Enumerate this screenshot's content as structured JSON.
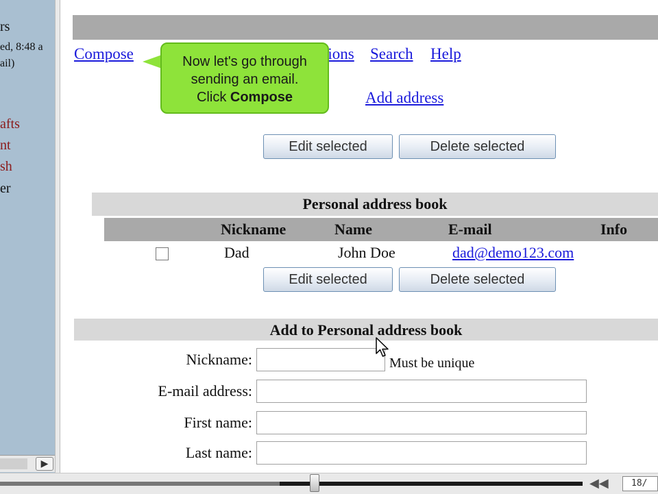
{
  "sidebar": {
    "lines": [
      "rs",
      "ed, 8:48 a",
      "ail)",
      "afts",
      "nt",
      "sh",
      "er"
    ],
    "scroll_right_glyph": "▶"
  },
  "nav": {
    "compose": "Compose",
    "options_partial": "tions",
    "search": "Search",
    "help": "Help",
    "add_address": "Add address"
  },
  "buttons": {
    "edit_selected": "Edit selected",
    "delete_selected": "Delete selected"
  },
  "address_book": {
    "title": "Personal address book",
    "columns": [
      "Nickname",
      "Name",
      "E-mail",
      "Info"
    ],
    "rows": [
      {
        "nickname": "Dad",
        "name": "John Doe",
        "email": "dad@demo123.com",
        "info": ""
      }
    ]
  },
  "add_form": {
    "title": "Add to Personal address book",
    "nickname_label": "Nickname:",
    "nickname_value": "",
    "nickname_hint": "Must be unique",
    "email_label": "E-mail address:",
    "email_value": "",
    "first_name_label": "First name:",
    "first_name_value": "",
    "last_name_label": "Last name:",
    "last_name_value": ""
  },
  "tooltip": {
    "line1": "Now let's go through",
    "line2": "sending an email.",
    "line3_prefix": "Click ",
    "line3_bold": "Compose"
  },
  "player": {
    "slide_counter": "18/",
    "progress_fraction": 0.48,
    "rewind_glyph": "◀◀"
  },
  "colors": {
    "link": "#1a1adb",
    "tooltip_bg": "#8ee33a",
    "header_bar": "#a9a9a9",
    "section_bar": "#d8d8d8",
    "sidebar_bg": "#a9bfd1"
  }
}
